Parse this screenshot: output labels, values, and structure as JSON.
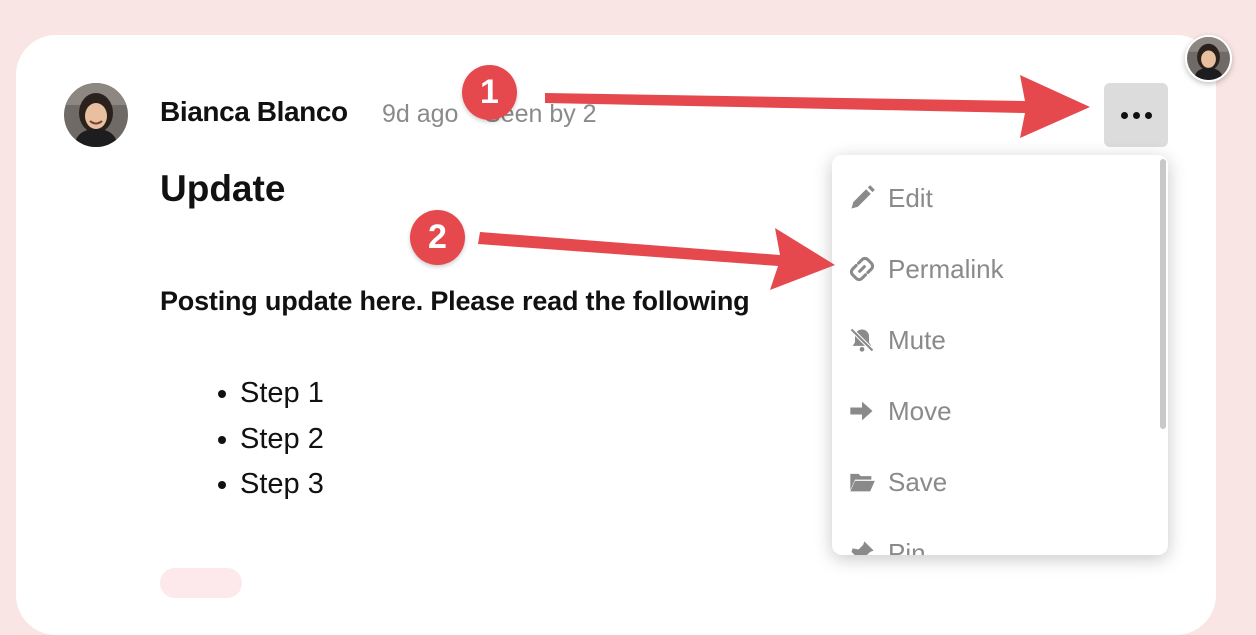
{
  "post": {
    "author": "Bianca Blanco",
    "time": "9d ago",
    "seen": "Seen by 2",
    "title": "Update",
    "body": "Posting update here. Please read the following",
    "steps": [
      "Step 1",
      "Step 2",
      "Step 3"
    ]
  },
  "menu": {
    "items": [
      {
        "label": "Edit",
        "icon": "pencil-icon"
      },
      {
        "label": "Permalink",
        "icon": "link-icon"
      },
      {
        "label": "Mute",
        "icon": "bell-slash-icon"
      },
      {
        "label": "Move",
        "icon": "arrow-right-icon"
      },
      {
        "label": "Save",
        "icon": "folder-open-icon"
      },
      {
        "label": "Pin",
        "icon": "pin-icon"
      }
    ]
  },
  "annotations": {
    "badges": [
      "1",
      "2"
    ],
    "color": "#e5484d"
  },
  "colors": {
    "page_background": "#f9e6e4",
    "menu_text": "#8a8a8a",
    "more_button_bg": "#dcdcdc"
  }
}
